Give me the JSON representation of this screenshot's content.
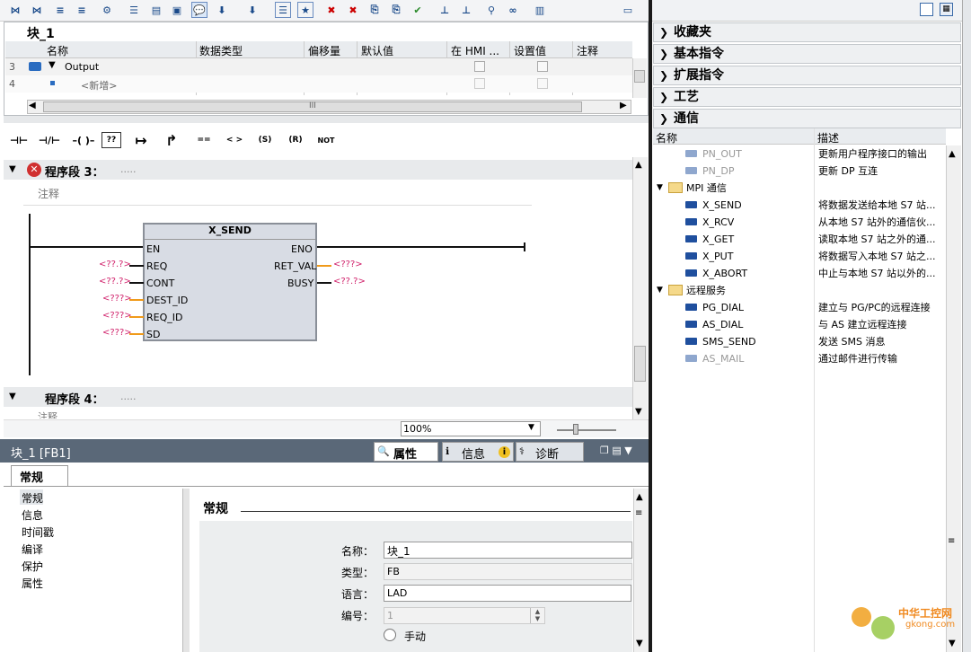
{
  "block_title": "块_1",
  "iface_headers": {
    "name": "名称",
    "type": "数据类型",
    "offset": "偏移量",
    "default": "默认值",
    "hmi": "在 HMI ...",
    "setval": "设置值",
    "comment": "注释"
  },
  "iface_rows": [
    {
      "num": "3",
      "name": "Output"
    },
    {
      "num": "4",
      "name": "<新增>"
    }
  ],
  "scroll_mid": "III",
  "network3": {
    "label": "程序段 3：",
    "dots": ".....",
    "comment": "注释"
  },
  "network4": {
    "label": "程序段 4：",
    "dots": ".....",
    "comment": "注释"
  },
  "fb": {
    "name": "X_SEND",
    "in": [
      "EN",
      "REQ",
      "CONT",
      "DEST_ID",
      "REQ_ID",
      "SD"
    ],
    "in_vals": [
      "",
      "<??.?>",
      "<??.?>",
      "<???>",
      "<???>",
      "<???>"
    ],
    "out": [
      "ENO",
      "RET_VAL",
      "BUSY"
    ],
    "out_vals": [
      "",
      "<???>",
      "<??.?>"
    ]
  },
  "zoom": "100%",
  "ladder_icons": [
    "⊣⊢",
    "⊣/⊢",
    "–( )–",
    "??",
    "↦",
    "↱",
    "==",
    "< >",
    "(S)",
    "(R)",
    "NOT"
  ],
  "bottom": {
    "title": "块_1 [FB1]",
    "tabs": [
      "属性",
      "信息",
      "诊断"
    ],
    "info_badge": "i",
    "subtab": "常规",
    "nav": [
      "常规",
      "信息",
      "时间戳",
      "编译",
      "保护",
      "属性"
    ],
    "section": "常规",
    "fields": {
      "name_label": "名称：",
      "name_value": "块_1",
      "type_label": "类型：",
      "type_value": "FB",
      "lang_label": "语言：",
      "lang_value": "LAD",
      "num_label": "编号：",
      "num_value": "1",
      "manual": "手动"
    }
  },
  "right": {
    "categories": [
      "收藏夹",
      "基本指令",
      "扩展指令",
      "工艺",
      "通信"
    ],
    "col_name": "名称",
    "col_desc": "描述",
    "items": [
      {
        "name": "PN_OUT",
        "desc": "更新用户程序接口的输出",
        "kind": "item",
        "dim": true
      },
      {
        "name": "PN_DP",
        "desc": "更新 DP 互连",
        "kind": "item",
        "dim": true
      },
      {
        "name": "MPI 通信",
        "desc": "",
        "kind": "folder"
      },
      {
        "name": "X_SEND",
        "desc": "将数据发送给本地 S7 站...",
        "kind": "item"
      },
      {
        "name": "X_RCV",
        "desc": "从本地 S7 站外的通信伙...",
        "kind": "item"
      },
      {
        "name": "X_GET",
        "desc": "读取本地 S7 站之外的通...",
        "kind": "item"
      },
      {
        "name": "X_PUT",
        "desc": "将数据写入本地 S7 站之...",
        "kind": "item"
      },
      {
        "name": "X_ABORT",
        "desc": "中止与本地 S7 站以外的...",
        "kind": "item"
      },
      {
        "name": "远程服务",
        "desc": "",
        "kind": "folder"
      },
      {
        "name": "PG_DIAL",
        "desc": "建立与 PG/PC的远程连接",
        "kind": "item"
      },
      {
        "name": "AS_DIAL",
        "desc": "与 AS 建立远程连接",
        "kind": "item"
      },
      {
        "name": "SMS_SEND",
        "desc": "发送 SMS 消息",
        "kind": "item"
      },
      {
        "name": "AS_MAIL",
        "desc": "通过邮件进行传输",
        "kind": "item",
        "dim": true
      }
    ]
  },
  "watermark": {
    "title": "中华工控网",
    "url": "gkong.com"
  }
}
